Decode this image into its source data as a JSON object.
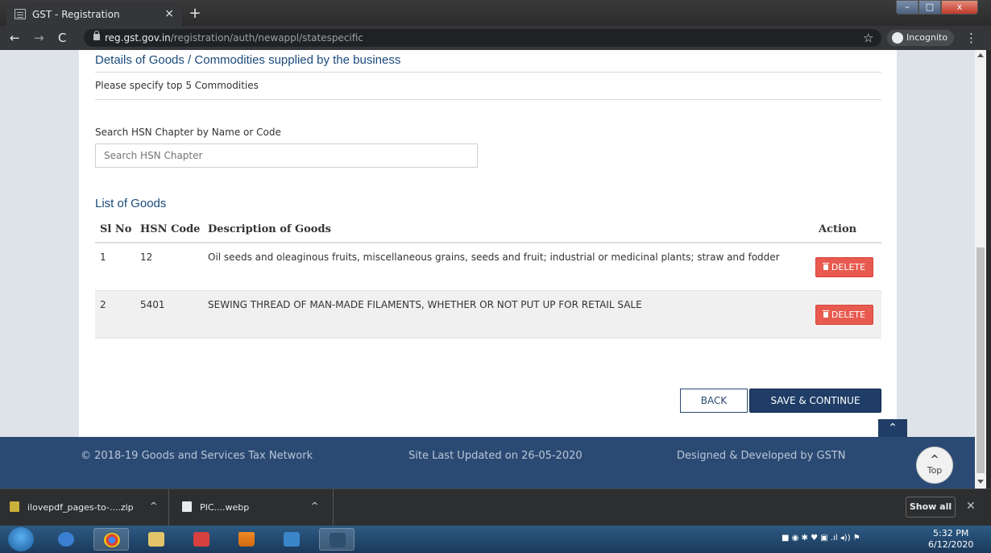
{
  "browser": {
    "tab_title": "GST - Registration",
    "tab_close": "×",
    "new_tab": "+",
    "url_host": "reg.gst.gov.in",
    "url_path": "/registration/auth/newappl/statespecific",
    "incognito_label": "Incognito",
    "win_min": "–",
    "win_max": "□",
    "win_close": "x"
  },
  "section": {
    "title": "Details of Goods / Commodities supplied by the business",
    "subtitle": "Please specify top 5 Commodities"
  },
  "search": {
    "label": "Search HSN Chapter by Name or Code",
    "placeholder": "Search HSN Chapter"
  },
  "list": {
    "title": "List of Goods",
    "headers": {
      "sl": "Sl No",
      "hsn": "HSN Code",
      "desc": "Description of Goods",
      "action": "Action"
    },
    "rows": [
      {
        "sl": "1",
        "hsn": "12",
        "desc": "Oil seeds and oleaginous fruits, miscellaneous grains, seeds and fruit; industrial or medicinal plants; straw and fodder",
        "action": "DELETE"
      },
      {
        "sl": "2",
        "hsn": "5401",
        "desc": "SEWING THREAD OF MAN-MADE FILAMENTS, WHETHER OR NOT PUT UP FOR RETAIL SALE",
        "action": "DELETE"
      }
    ]
  },
  "buttons": {
    "back": "BACK",
    "save_continue": "SAVE & CONTINUE"
  },
  "footer": {
    "copyright": "© 2018-19 Goods and Services Tax Network",
    "updated": "Site Last Updated on 26-05-2020",
    "developed": "Designed & Developed by GSTN",
    "top_label": "Top"
  },
  "downloads": {
    "item1": "ilovepdf_pages-to-....zip",
    "item2": "PIC....webp",
    "show_all": "Show all"
  },
  "taskbar": {
    "time": "5:32 PM",
    "date": "6/12/2020"
  },
  "colors": {
    "primary": "#1f3d66",
    "delete": "#e85a4f",
    "footer": "#2b4a73",
    "heading": "#1a4a7a"
  }
}
